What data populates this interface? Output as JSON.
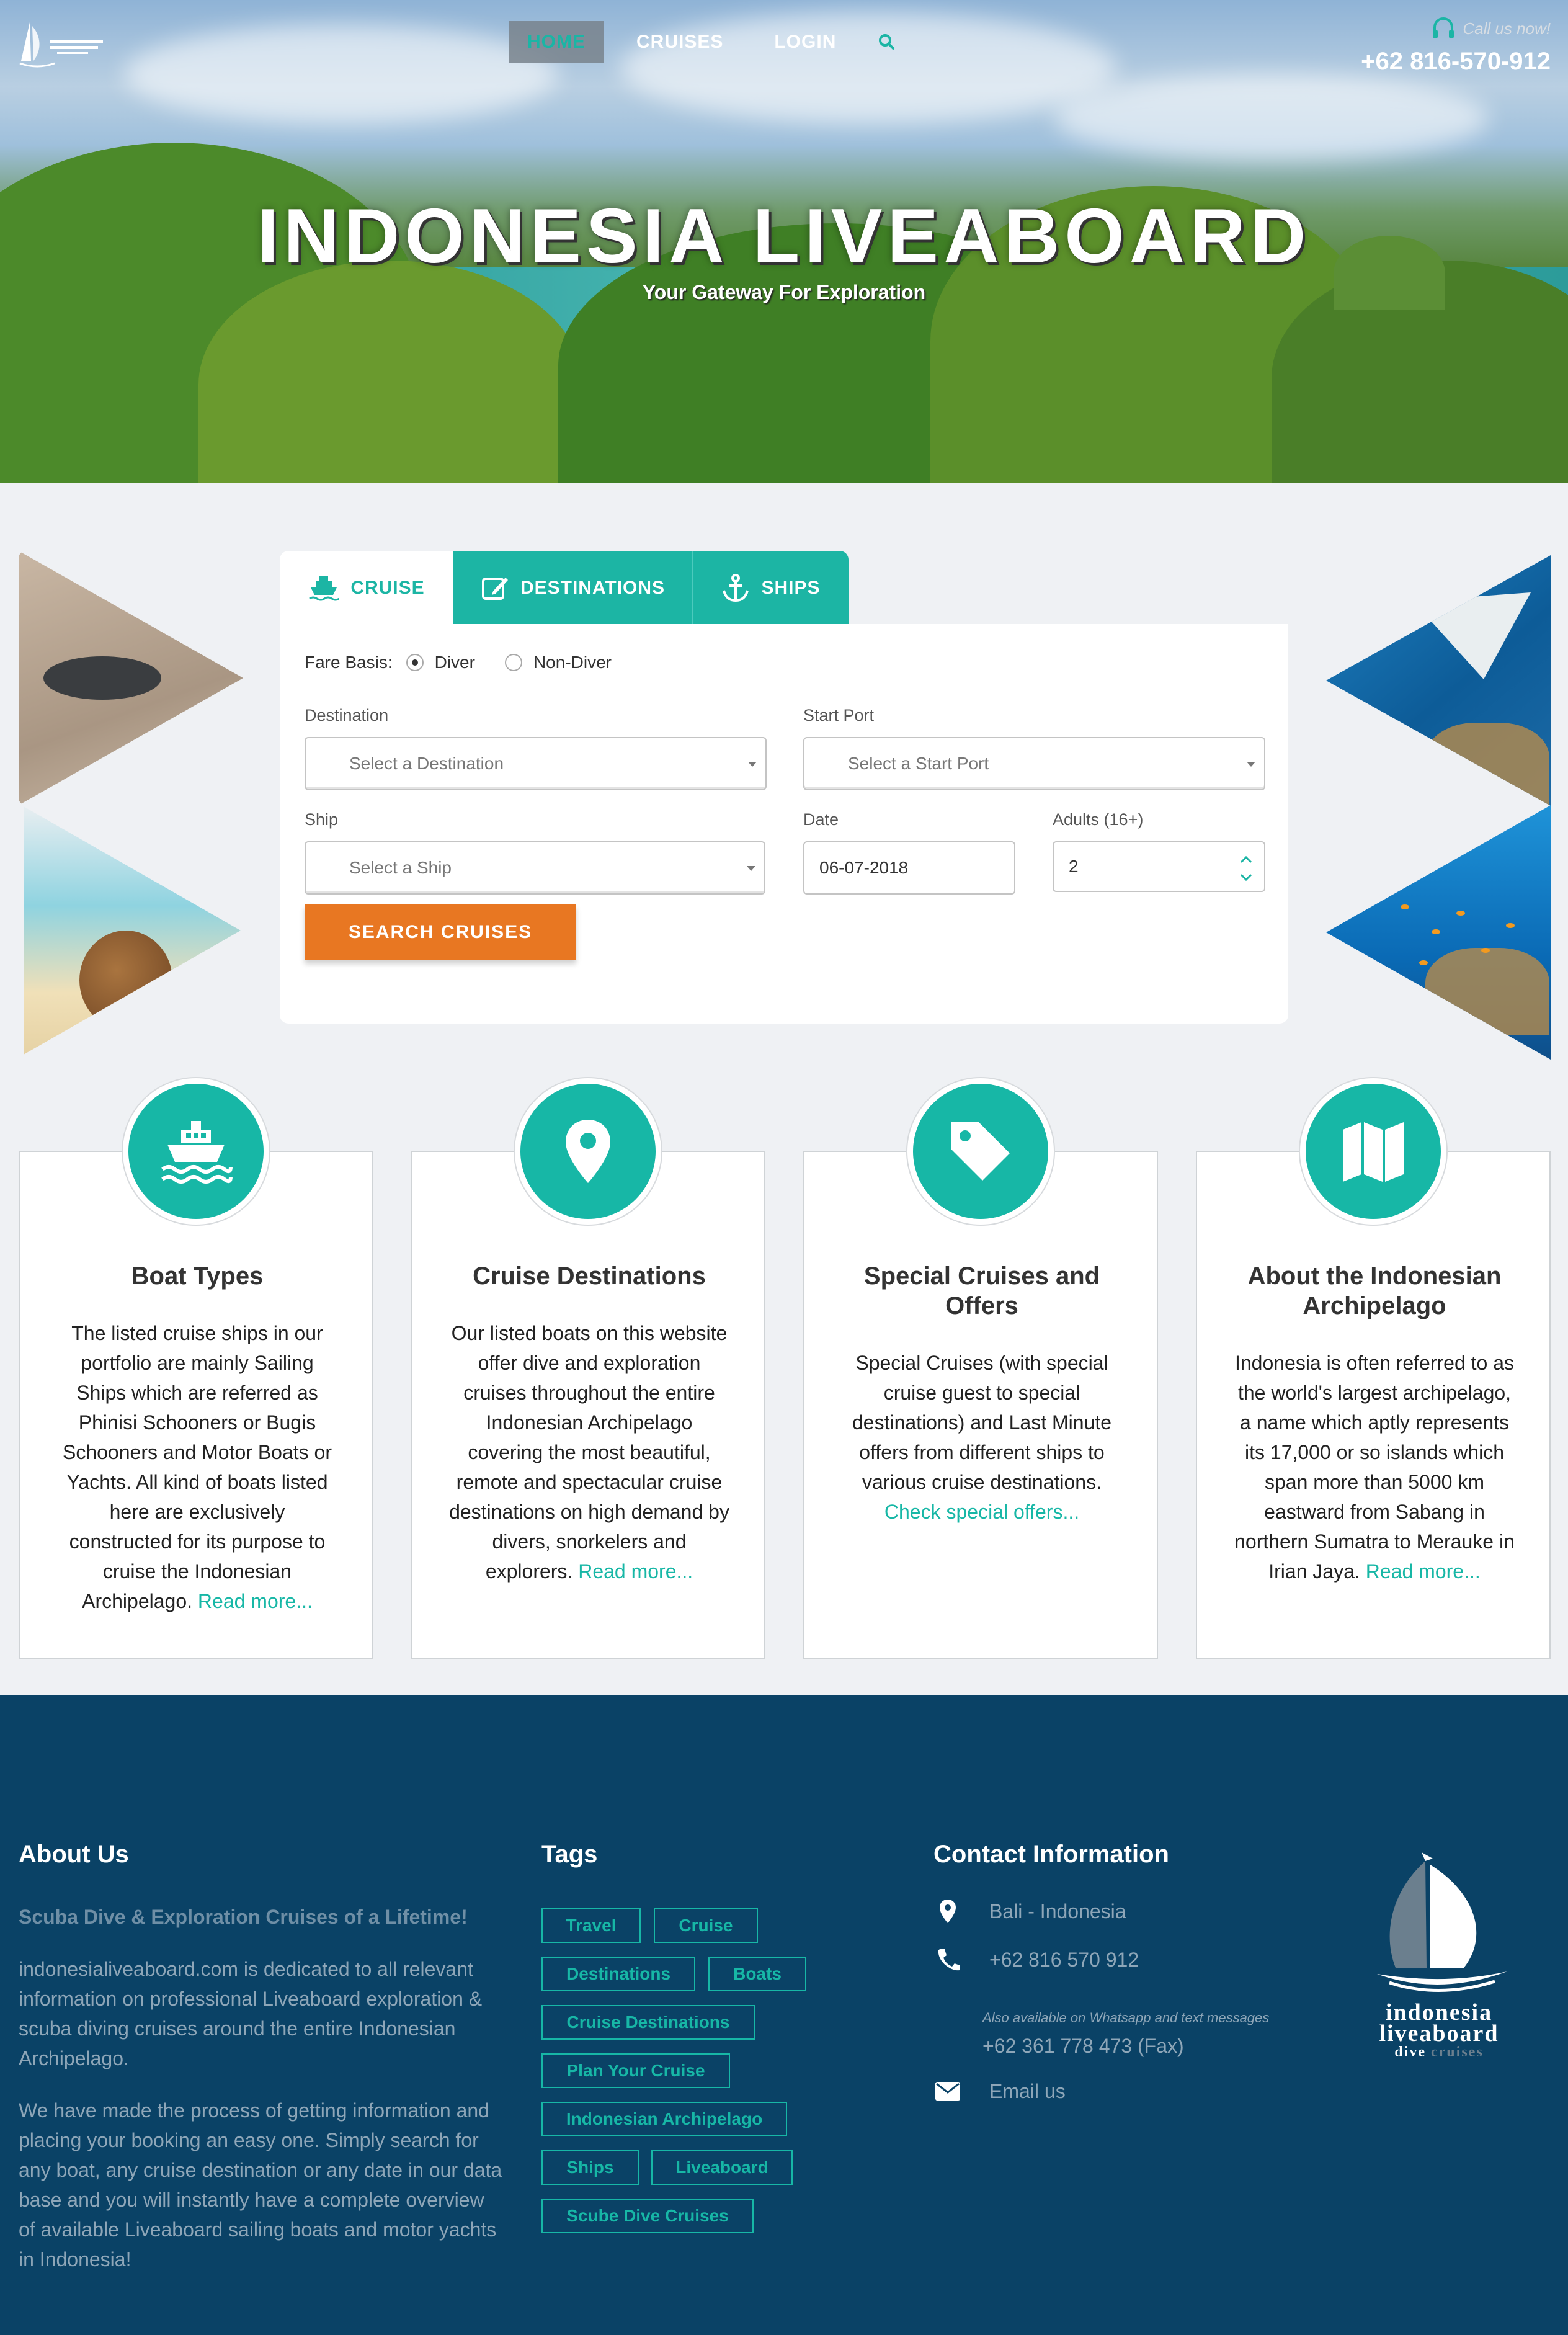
{
  "header": {
    "logo_alt": "Indonesia Liveaboard",
    "nav": [
      {
        "label": "HOME"
      },
      {
        "label": "CRUISES"
      },
      {
        "label": "LOGIN"
      }
    ],
    "call_label": "Call us now!",
    "phone": "+62 816-570-912"
  },
  "hero": {
    "title": "INDONESIA LIVEABOARD",
    "subtitle": "Your Gateway For Exploration"
  },
  "search": {
    "tabs": {
      "cruise": "CRUISE",
      "destinations": "DESTINATIONS",
      "ships": "SHIPS"
    },
    "fare_basis_label": "Fare Basis:",
    "fare_options": {
      "diver": "Diver",
      "non_diver": "Non-Diver"
    },
    "fare_selected": "Diver",
    "destination_label": "Destination",
    "destination_placeholder": "Select a Destination",
    "start_port_label": "Start Port",
    "start_port_placeholder": "Select a Start Port",
    "ship_label": "Ship",
    "ship_placeholder": "Select a Ship",
    "date_label": "Date",
    "date_value": "06-07-2018",
    "adults_label": "Adults (16+)",
    "adults_value": "2",
    "submit_label": "SEARCH CRUISES"
  },
  "features": [
    {
      "title": "Boat Types",
      "icon": "ship-icon",
      "body": "The listed cruise ships in our portfolio are mainly Sailing Ships which are referred as Phinisi Schooners or Bugis Schooners and Motor Boats or Yachts. All kind of boats listed here are exclusively constructed for its purpose to cruise the Indonesian Archipelago.",
      "link": "Read more..."
    },
    {
      "title": "Cruise Destinations",
      "icon": "map-marker-icon",
      "body": "Our listed boats on this website offer dive and exploration cruises throughout the entire Indonesian Archipelago covering the most beautiful, remote and spectacular cruise destinations on high demand by divers, snorkelers and explorers.",
      "link": "Read more..."
    },
    {
      "title": "Special Cruises and Offers",
      "icon": "tag-icon",
      "body": "Special Cruises (with special cruise guest to special destinations) and Last Minute offers from different ships to various cruise destinations.",
      "link": "Check special offers..."
    },
    {
      "title": "About the Indonesian Archipelago",
      "icon": "map-icon",
      "body": "Indonesia is often referred to as the world's largest archipelago, a name which aptly represents its 17,000 or so islands which span more than 5000 km eastward from Sabang in northern Sumatra to Merauke in Irian Jaya.",
      "link": "Read more..."
    }
  ],
  "footer": {
    "about": {
      "heading": "About Us",
      "tagline": "Scuba Dive & Exploration Cruises of a Lifetime!",
      "p1": "indonesialiveaboard.com is dedicated to all relevant information on professional Liveaboard exploration & scuba diving cruises around the entire Indonesian Archipelago.",
      "p2": "We have made the process of getting information and placing your booking an easy one. Simply search for any boat, any cruise destination or any date in our data base and you will instantly have a complete overview of available Liveaboard sailing boats and motor yachts in Indonesia!"
    },
    "tags": {
      "heading": "Tags",
      "items": [
        "Travel",
        "Cruise",
        "Destinations",
        "Boats",
        "Cruise Destinations",
        "Plan Your Cruise",
        "Indonesian Archipelago",
        "Ships",
        "Liveaboard",
        "Scube Dive Cruises"
      ]
    },
    "contact": {
      "heading": "Contact Information",
      "location": "Bali - Indonesia",
      "phone": "+62 816 570 912",
      "phone_note": "Also available on Whatsapp and text messages",
      "fax": "+62 361 778 473 (Fax)",
      "email": "Email us"
    },
    "logo": {
      "line1": "indonesia",
      "line2": "liveaboard",
      "line3a": "dive",
      "line3b": "cruises"
    }
  },
  "colors": {
    "accent": "#17b7a6",
    "button": "#e87722",
    "footer_bg": "#0a4266"
  }
}
